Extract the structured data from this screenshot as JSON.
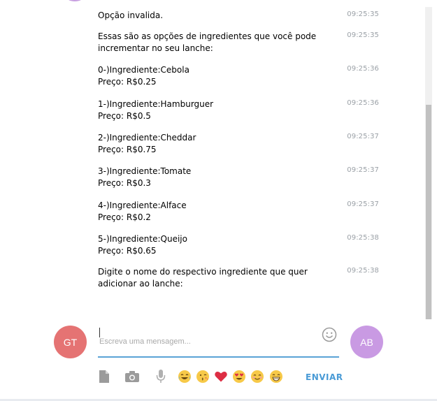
{
  "messages": [
    {
      "lines": [
        "Opção invalida."
      ],
      "time": "09:25:35"
    },
    {
      "lines": [
        "Essas são as opções de ingredientes que você pode incrementar no seu lanche:"
      ],
      "time": "09:25:35"
    },
    {
      "lines": [
        "0-)Ingrediente:Cebola",
        "Preço: R$0.25"
      ],
      "time": "09:25:36"
    },
    {
      "lines": [
        "1-)Ingrediente:Hamburguer",
        "Preço: R$0.5"
      ],
      "time": "09:25:36"
    },
    {
      "lines": [
        "2-)Ingrediente:Cheddar",
        "Preço: R$0.75"
      ],
      "time": "09:25:37"
    },
    {
      "lines": [
        "3-)Ingrediente:Tomate",
        "Preço: R$0.3"
      ],
      "time": "09:25:37"
    },
    {
      "lines": [
        "4-)Ingrediente:Alface",
        "Preço: R$0.2"
      ],
      "time": "09:25:37"
    },
    {
      "lines": [
        "5-)Ingrediente:Queijo",
        "Preço: R$0.65"
      ],
      "time": "09:25:38"
    },
    {
      "lines": [
        "Digite o nome do respectivo ingrediente que quer adicionar ao lanche:"
      ],
      "time": "09:25:38"
    }
  ],
  "composer": {
    "placeholder": "Escreva uma mensagem...",
    "send_label": "ENVIAR"
  },
  "avatars": {
    "left": {
      "initials": "GT",
      "color": "#e57373"
    },
    "right": {
      "initials": "AB",
      "color": "#c99ae3"
    }
  },
  "toolbar": {
    "icons": [
      "file-icon",
      "camera-icon",
      "microphone-icon",
      "joy-emoji",
      "kiss-emoji",
      "heart-emoji",
      "heart-eyes-emoji",
      "blush-emoji",
      "grin-emoji"
    ]
  },
  "colors": {
    "accent": "#4a9bd6",
    "input_underline": "#5aa3d6"
  }
}
